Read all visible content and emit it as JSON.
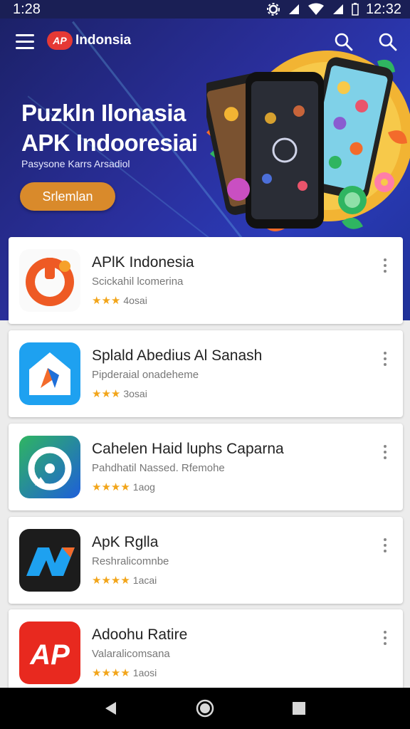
{
  "status": {
    "time_left": "1:28",
    "time_right": "12:32"
  },
  "header": {
    "brand_logo": "AP",
    "brand_name": "Indonsia"
  },
  "hero": {
    "title_line1": "Puzkln Ilonasia",
    "title_line2": "APK Indooresiai",
    "subtitle": "Pasysone Karrs Arsadiol",
    "button_label": "Srlemlan"
  },
  "apps": [
    {
      "name": "APlK Indonesia",
      "subtitle": "Scickahil lcomerina",
      "stars": "★★★",
      "rating": "4osai",
      "icon": "orange-power-logo-icon"
    },
    {
      "name": "Splald Abedius Al Sanash",
      "subtitle": "Pipderaial onadeheme",
      "stars": "★★★",
      "rating": "3osai",
      "icon": "blue-house-logo-icon"
    },
    {
      "name": "Cahelen Haid luphs Caparna",
      "subtitle": "Pahdhatil Nassed. Rfemohe",
      "stars": "★★★★",
      "rating": "1aog",
      "icon": "green-chat-logo-icon"
    },
    {
      "name": "ApK Rglla",
      "subtitle": "Reshralicomnbe",
      "stars": "★★★★",
      "rating": "1acai",
      "icon": "dark-n-logo-icon"
    },
    {
      "name": "Adoohu Ratire",
      "subtitle": "Valaralicomsana",
      "stars": "★★★★",
      "rating": "1aosi",
      "icon": "red-ap-logo-icon"
    }
  ],
  "colors": {
    "hero_bg": "#1c2168",
    "accent_button": "#d98a2b",
    "star": "#f2a51a",
    "brand_red": "#e53935"
  }
}
